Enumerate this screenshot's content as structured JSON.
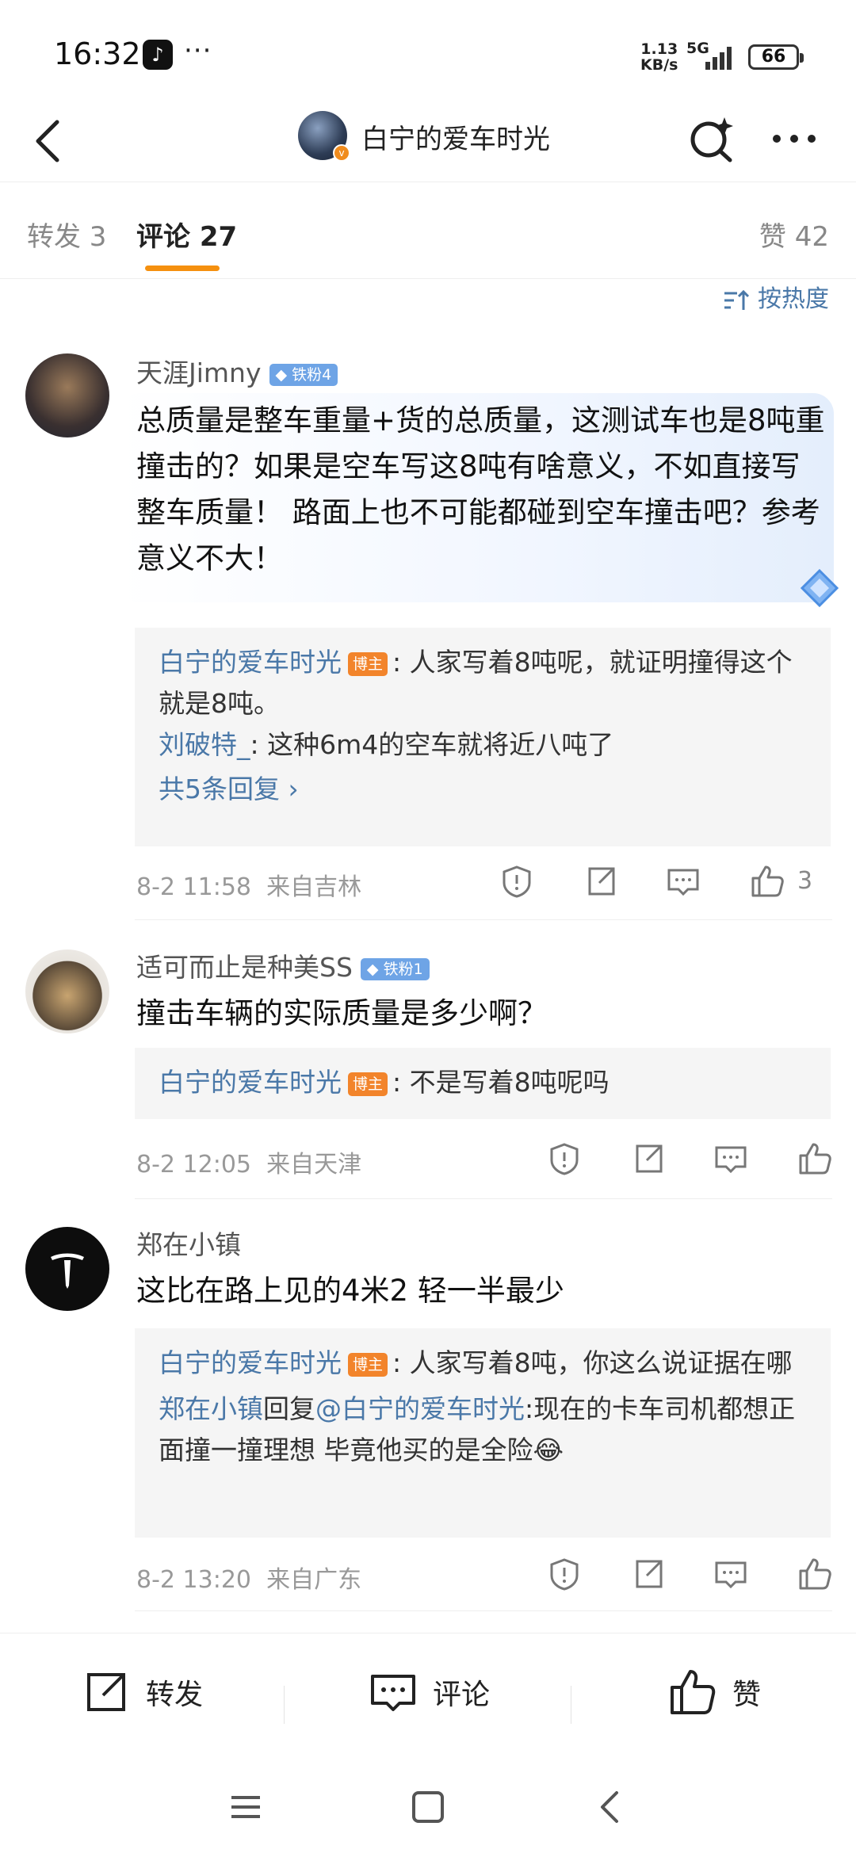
{
  "status_bar": {
    "time": "16:32",
    "dots": "···",
    "net_speed_top": "1.13",
    "net_speed_bottom": "KB/s",
    "network": "5G",
    "battery": "66"
  },
  "nav": {
    "title": "白宁的爱车时光",
    "badge": "v"
  },
  "tabs": {
    "repost": "转发 3",
    "comments": "评论 27",
    "likes": "赞 42"
  },
  "sort_label": "按热度",
  "comments": [
    {
      "name": "天涯Jimny",
      "fan_badge": "铁粉4",
      "text": "总质量是整车重量+货的总质量，这测试车也是8吨重撞击的？如果是空车写这8吨有啥意义，不如直接写整车质量！ 路面上也不可能都碰到空车撞击吧？参考意义不大！",
      "replies": [
        {
          "name": "白宁的爱车时光",
          "host_badge": "博主",
          "text": ": 人家写着8吨呢，就证明撞得这个就是8吨。"
        },
        {
          "name": "刘破特_",
          "text": ": 这种6m4的空车就将近八吨了"
        }
      ],
      "more_replies": "共5条回复 ›",
      "time": "8-2 11:58",
      "location": "来自吉林",
      "like_count": "3"
    },
    {
      "name": "适可而止是种美SS",
      "fan_badge": "铁粉1",
      "text": "撞击车辆的实际质量是多少啊？",
      "replies": [
        {
          "name": "白宁的爱车时光",
          "host_badge": "博主",
          "text": ": 不是写着8吨呢吗"
        }
      ],
      "time": "8-2 12:05",
      "location": "来自天津"
    },
    {
      "name": "郑在小镇",
      "text": "这比在路上见的4米2 轻一半最少",
      "replies": [
        {
          "name": "白宁的爱车时光",
          "host_badge": "博主",
          "text": ": 人家写着8吨，你这么说证据在哪"
        },
        {
          "name": "郑在小镇",
          "reply_word": "回复",
          "target": "@白宁的爱车时光",
          "text": ":现在的卡车司机都想正面撞一撞理想 毕竟他买的是全险😂"
        }
      ],
      "time": "8-2 13:20",
      "location": "来自广东"
    }
  ],
  "bottom_bar": {
    "repost": "转发",
    "comment": "评论",
    "like": "赞"
  }
}
